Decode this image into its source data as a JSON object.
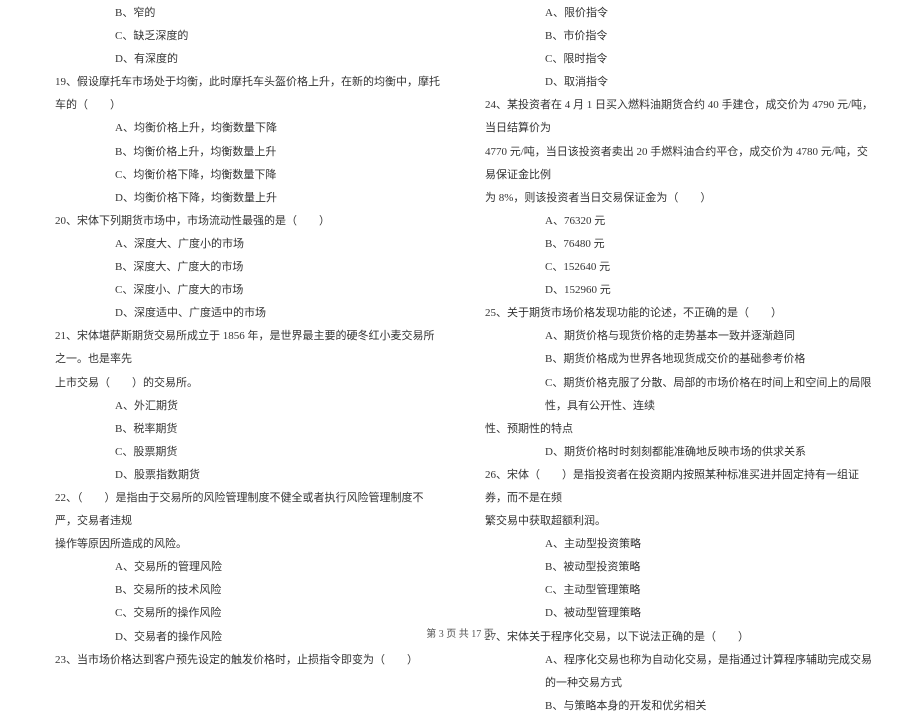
{
  "left": {
    "opt_b": "B、窄的",
    "opt_c": "C、缺乏深度的",
    "opt_d": "D、有深度的",
    "q19": "19、假设摩托车市场处于均衡，此时摩托车头盔价格上升，在新的均衡中，摩托车的（　　）",
    "q19_a": "A、均衡价格上升，均衡数量下降",
    "q19_b": "B、均衡价格上升，均衡数量上升",
    "q19_c": "C、均衡价格下降，均衡数量下降",
    "q19_d": "D、均衡价格下降，均衡数量上升",
    "q20": "20、宋体下列期货市场中，市场流动性最强的是（　　）",
    "q20_a": "A、深度大、广度小的市场",
    "q20_b": "B、深度大、广度大的市场",
    "q20_c": "C、深度小、广度大的市场",
    "q20_d": "D、深度适中、广度适中的市场",
    "q21": "21、宋体堪萨斯期货交易所成立于 1856 年，是世界最主要的硬冬红小麦交易所之一。也是率先",
    "q21_cont": "上市交易（　　）的交易所。",
    "q21_a": "A、外汇期货",
    "q21_b": "B、税率期货",
    "q21_c": "C、股票期货",
    "q21_d": "D、股票指数期货",
    "q22": "22、（　　）是指由于交易所的风险管理制度不健全或者执行风险管理制度不严，交易者违规",
    "q22_cont": "操作等原因所造成的风险。",
    "q22_a": "A、交易所的管理风险",
    "q22_b": "B、交易所的技术风险",
    "q22_c": "C、交易所的操作风险",
    "q22_d": "D、交易者的操作风险",
    "q23": "23、当市场价格达到客户预先设定的触发价格时，止损指令即变为（　　）"
  },
  "right": {
    "opt_a": "A、限价指令",
    "opt_b": "B、市价指令",
    "opt_c": "C、限时指令",
    "opt_d": "D、取消指令",
    "q24": "24、某投资者在 4 月 1 日买入燃料油期货合约 40 手建仓，成交价为 4790 元/吨，当日结算价为",
    "q24_cont1": "4770 元/吨，当日该投资者卖出 20 手燃料油合约平仓，成交价为 4780 元/吨，交易保证金比例",
    "q24_cont2": "为 8%，则该投资者当日交易保证金为（　　）",
    "q24_a": "A、76320 元",
    "q24_b": "B、76480 元",
    "q24_c": "C、152640 元",
    "q24_d": "D、152960 元",
    "q25": "25、关于期货市场价格发现功能的论述，不正确的是（　　）",
    "q25_a": "A、期货价格与现货价格的走势基本一致并逐渐趋同",
    "q25_b": "B、期货价格成为世界各地现货成交价的基础参考价格",
    "q25_c": "C、期货价格克服了分散、局部的市场价格在时间上和空间上的局限性，具有公开性、连续",
    "q25_c_cont": "性、预期性的特点",
    "q25_d": "D、期货价格时时刻刻都能准确地反映市场的供求关系",
    "q26": "26、宋体（　　）是指投资者在投资期内按照某种标准买进并固定持有一组证券，而不是在频",
    "q26_cont": "繁交易中获取超额利润。",
    "q26_a": "A、主动型投资策略",
    "q26_b": "B、被动型投资策略",
    "q26_c": "C、主动型管理策略",
    "q26_d": "D、被动型管理策略",
    "q27": "27、宋体关于程序化交易，以下说法正确的是（　　）",
    "q27_a": "A、程序化交易也称为自动化交易，是指通过计算程序辅助完成交易的一种交易方式",
    "q27_b": "B、与策略本身的开发和优劣相关"
  },
  "footer": "第 3 页 共 17 页"
}
